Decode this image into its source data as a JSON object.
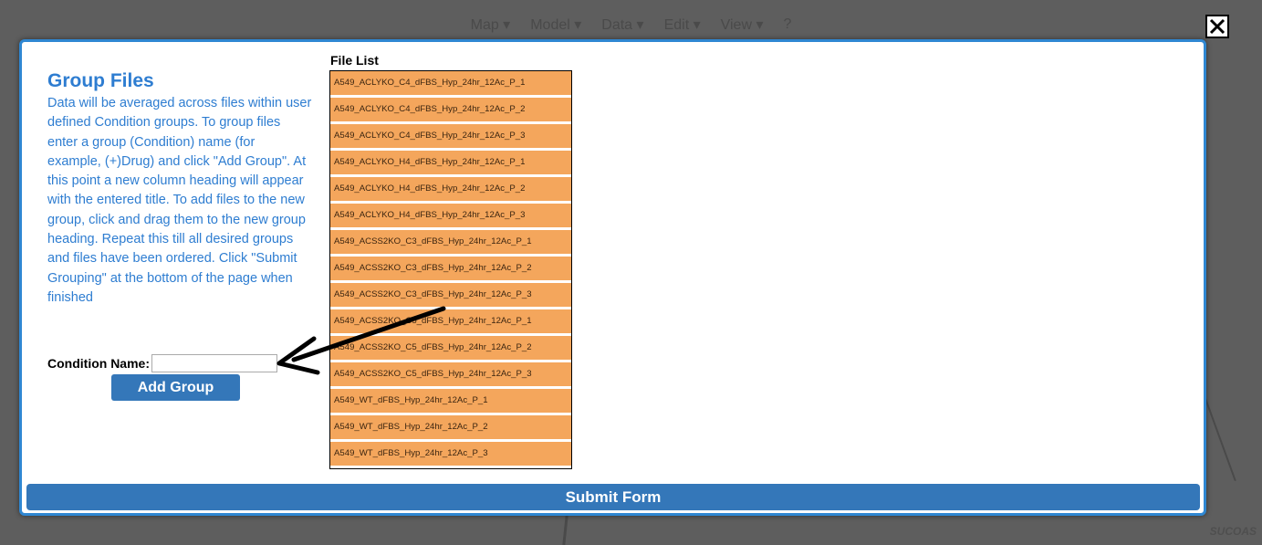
{
  "background": {
    "menu": [
      "Map ▾",
      "Model ▾",
      "Data ▾",
      "Edit ▾",
      "View ▾",
      "?"
    ],
    "corner_text": "SUCOAS"
  },
  "modal": {
    "title": "Group Files",
    "instructions": "Data will be averaged across files within user defined Condition groups. To group files enter a group (Condition) name (for example, (+)Drug) and click \"Add Group\". At this point a new column heading will appear with the entered title. To add files to the new group, click and drag them to the new group heading. Repeat this till all desired groups and files have been ordered. Click \"Submit Grouping\" at the bottom of the page when finished",
    "condition_label": "Condition Name:",
    "condition_value": "",
    "add_group_label": "Add Group",
    "file_list_title": "File List",
    "files": [
      "A549_ACLYKO_C4_dFBS_Hyp_24hr_12Ac_P_1",
      "A549_ACLYKO_C4_dFBS_Hyp_24hr_12Ac_P_2",
      "A549_ACLYKO_C4_dFBS_Hyp_24hr_12Ac_P_3",
      "A549_ACLYKO_H4_dFBS_Hyp_24hr_12Ac_P_1",
      "A549_ACLYKO_H4_dFBS_Hyp_24hr_12Ac_P_2",
      "A549_ACLYKO_H4_dFBS_Hyp_24hr_12Ac_P_3",
      "A549_ACSS2KO_C3_dFBS_Hyp_24hr_12Ac_P_1",
      "A549_ACSS2KO_C3_dFBS_Hyp_24hr_12Ac_P_2",
      "A549_ACSS2KO_C3_dFBS_Hyp_24hr_12Ac_P_3",
      "A549_ACSS2KO_C5_dFBS_Hyp_24hr_12Ac_P_1",
      "A549_ACSS2KO_C5_dFBS_Hyp_24hr_12Ac_P_2",
      "A549_ACSS2KO_C5_dFBS_Hyp_24hr_12Ac_P_3",
      "A549_WT_dFBS_Hyp_24hr_12Ac_P_1",
      "A549_WT_dFBS_Hyp_24hr_12Ac_P_2",
      "A549_WT_dFBS_Hyp_24hr_12Ac_P_3"
    ],
    "submit_label": "Submit Form"
  },
  "colors": {
    "accent_blue": "#2e7dd1",
    "button_blue": "#3477b9",
    "file_item": "#f4a65c",
    "overlay": "#5e5e5e"
  },
  "icons": {
    "close": "close-x-icon",
    "annotation": "arrow-annotation-icon"
  }
}
